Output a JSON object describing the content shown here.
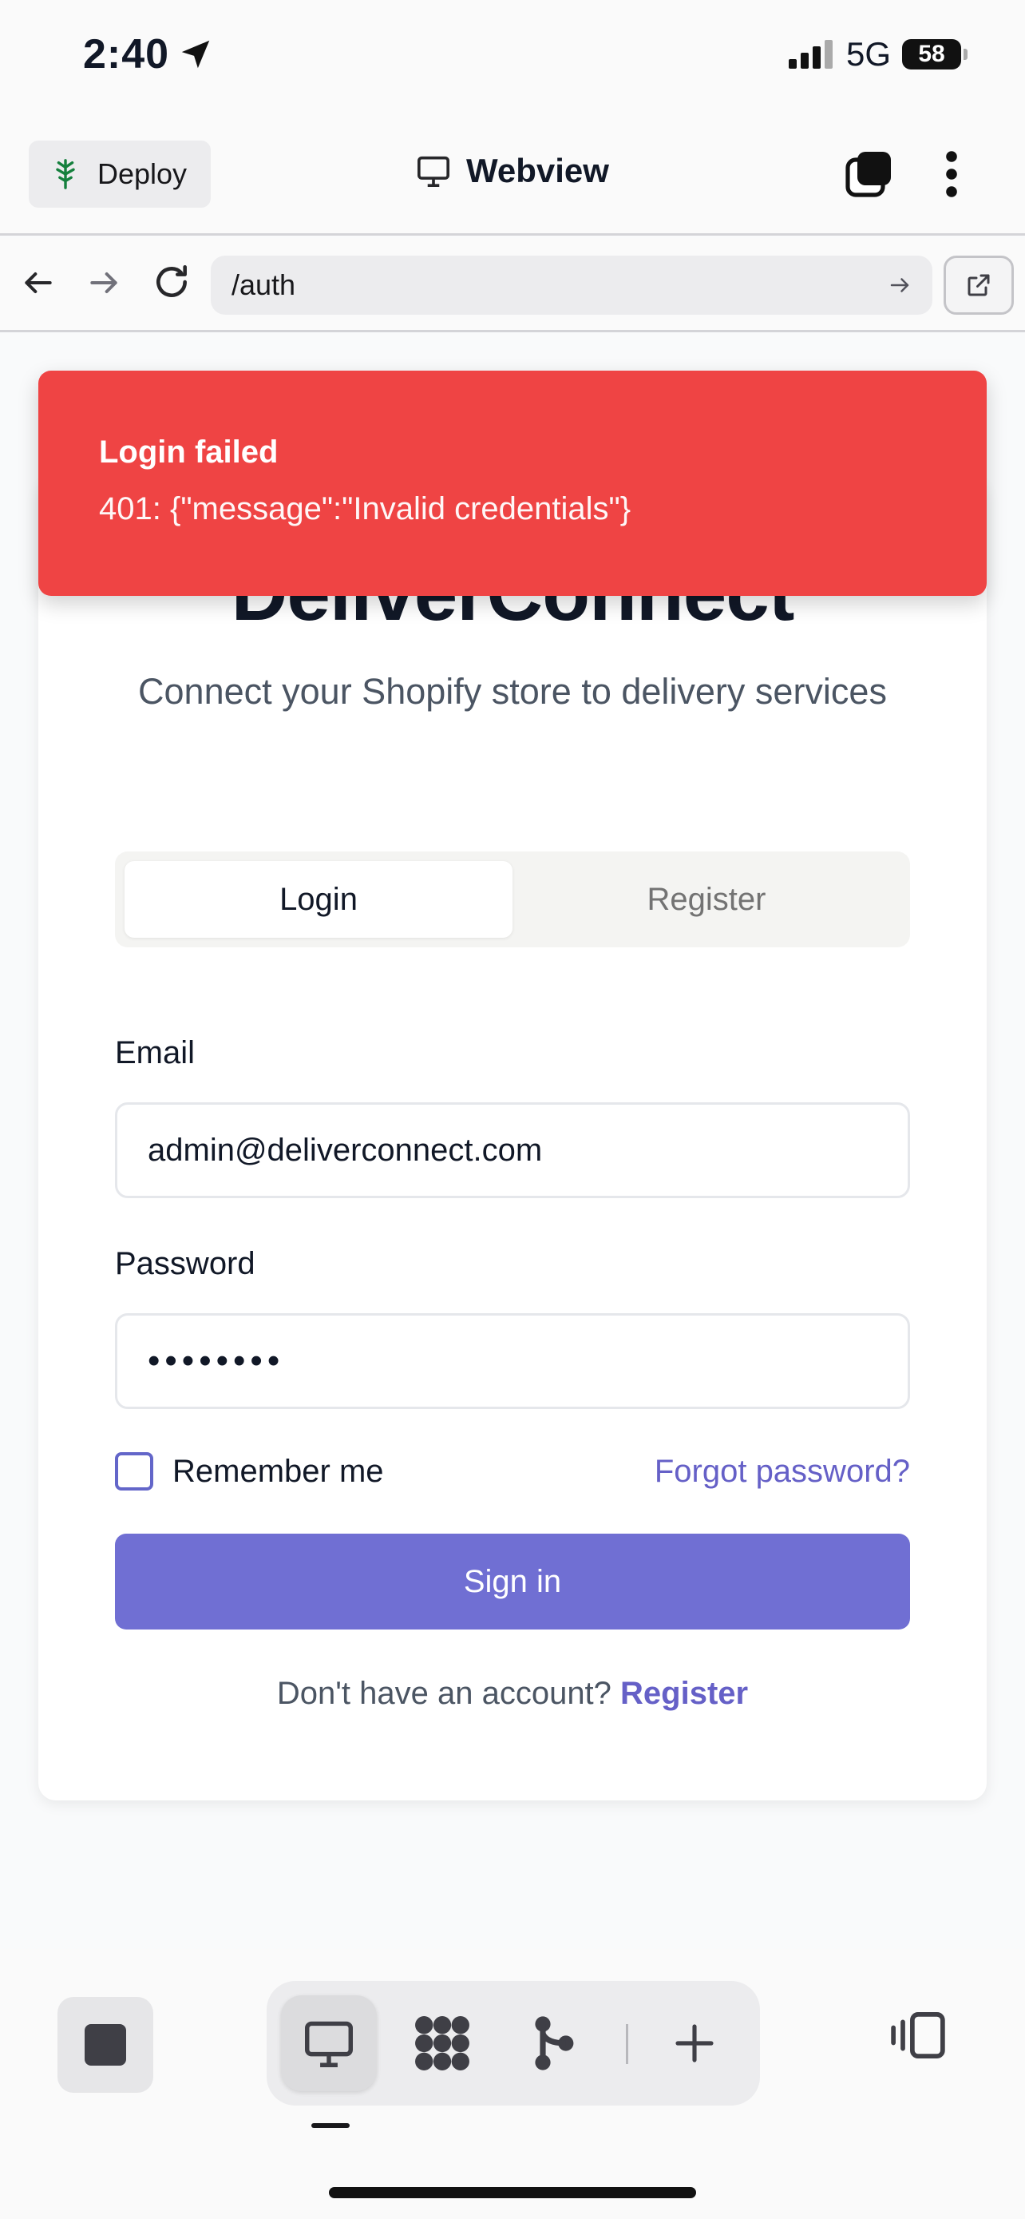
{
  "status_bar": {
    "time": "2:40",
    "network": "5G",
    "battery": "58"
  },
  "app_bar": {
    "deploy_label": "Deploy",
    "title": "Webview"
  },
  "url_bar": {
    "url": "/auth"
  },
  "toast": {
    "title": "Login failed",
    "message": "401: {\"message\":\"Invalid credentials\"}"
  },
  "card": {
    "brand": "DeliverConnect",
    "subtitle": "Connect your Shopify store to delivery services",
    "tabs": [
      {
        "label": "Login",
        "active": true
      },
      {
        "label": "Register",
        "active": false
      }
    ],
    "email_label": "Email",
    "email_value": "admin@deliverconnect.com",
    "password_label": "Password",
    "password_value": "••••••••",
    "remember_label": "Remember me",
    "remember_checked": false,
    "forgot_label": "Forgot password?",
    "signin_label": "Sign in",
    "footer_text": "Don't have an account?",
    "footer_link": "Register"
  },
  "colors": {
    "accent": "#706fd3",
    "link": "#6560c7",
    "toast_bg": "#ef4444"
  },
  "bottom_bar": {
    "icons": [
      "stop-icon",
      "monitor-icon",
      "apps-grid-icon",
      "branch-icon",
      "plus-icon",
      "side-panel-icon"
    ]
  }
}
